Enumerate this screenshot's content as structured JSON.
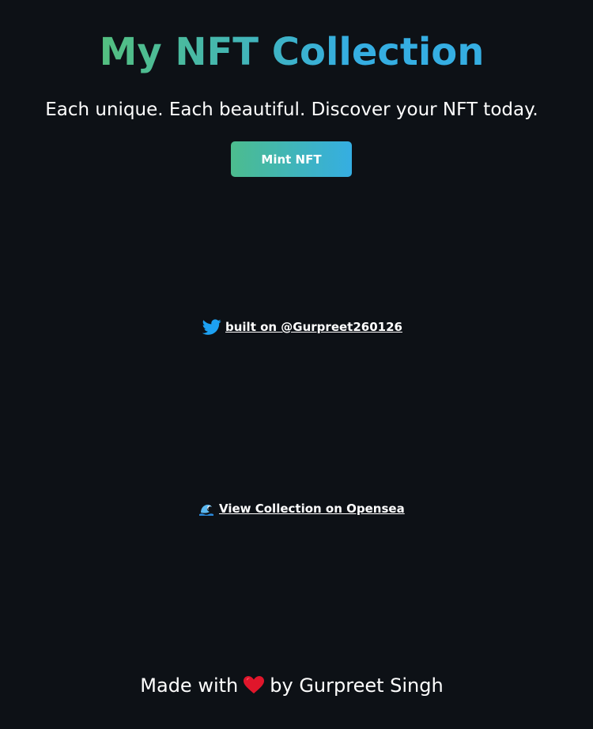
{
  "header": {
    "title": "My NFT Collection",
    "subtitle": "Each unique. Each beautiful. Discover your NFT today.",
    "mint_button_label": "Mint NFT"
  },
  "twitter": {
    "icon": "twitter-icon",
    "link_text": "built on @Gurpreet260126"
  },
  "opensea": {
    "icon": "wave-icon",
    "link_text": "View Collection on Opensea"
  },
  "footer": {
    "prefix": "Made with",
    "icon": "heart-icon",
    "suffix": "by Gurpreet Singh"
  },
  "colors": {
    "background": "#0d1116",
    "gradient_start": "#60c657",
    "gradient_end": "#35aee2",
    "twitter_blue": "#1da1f2",
    "heart_red": "#e0162b"
  }
}
